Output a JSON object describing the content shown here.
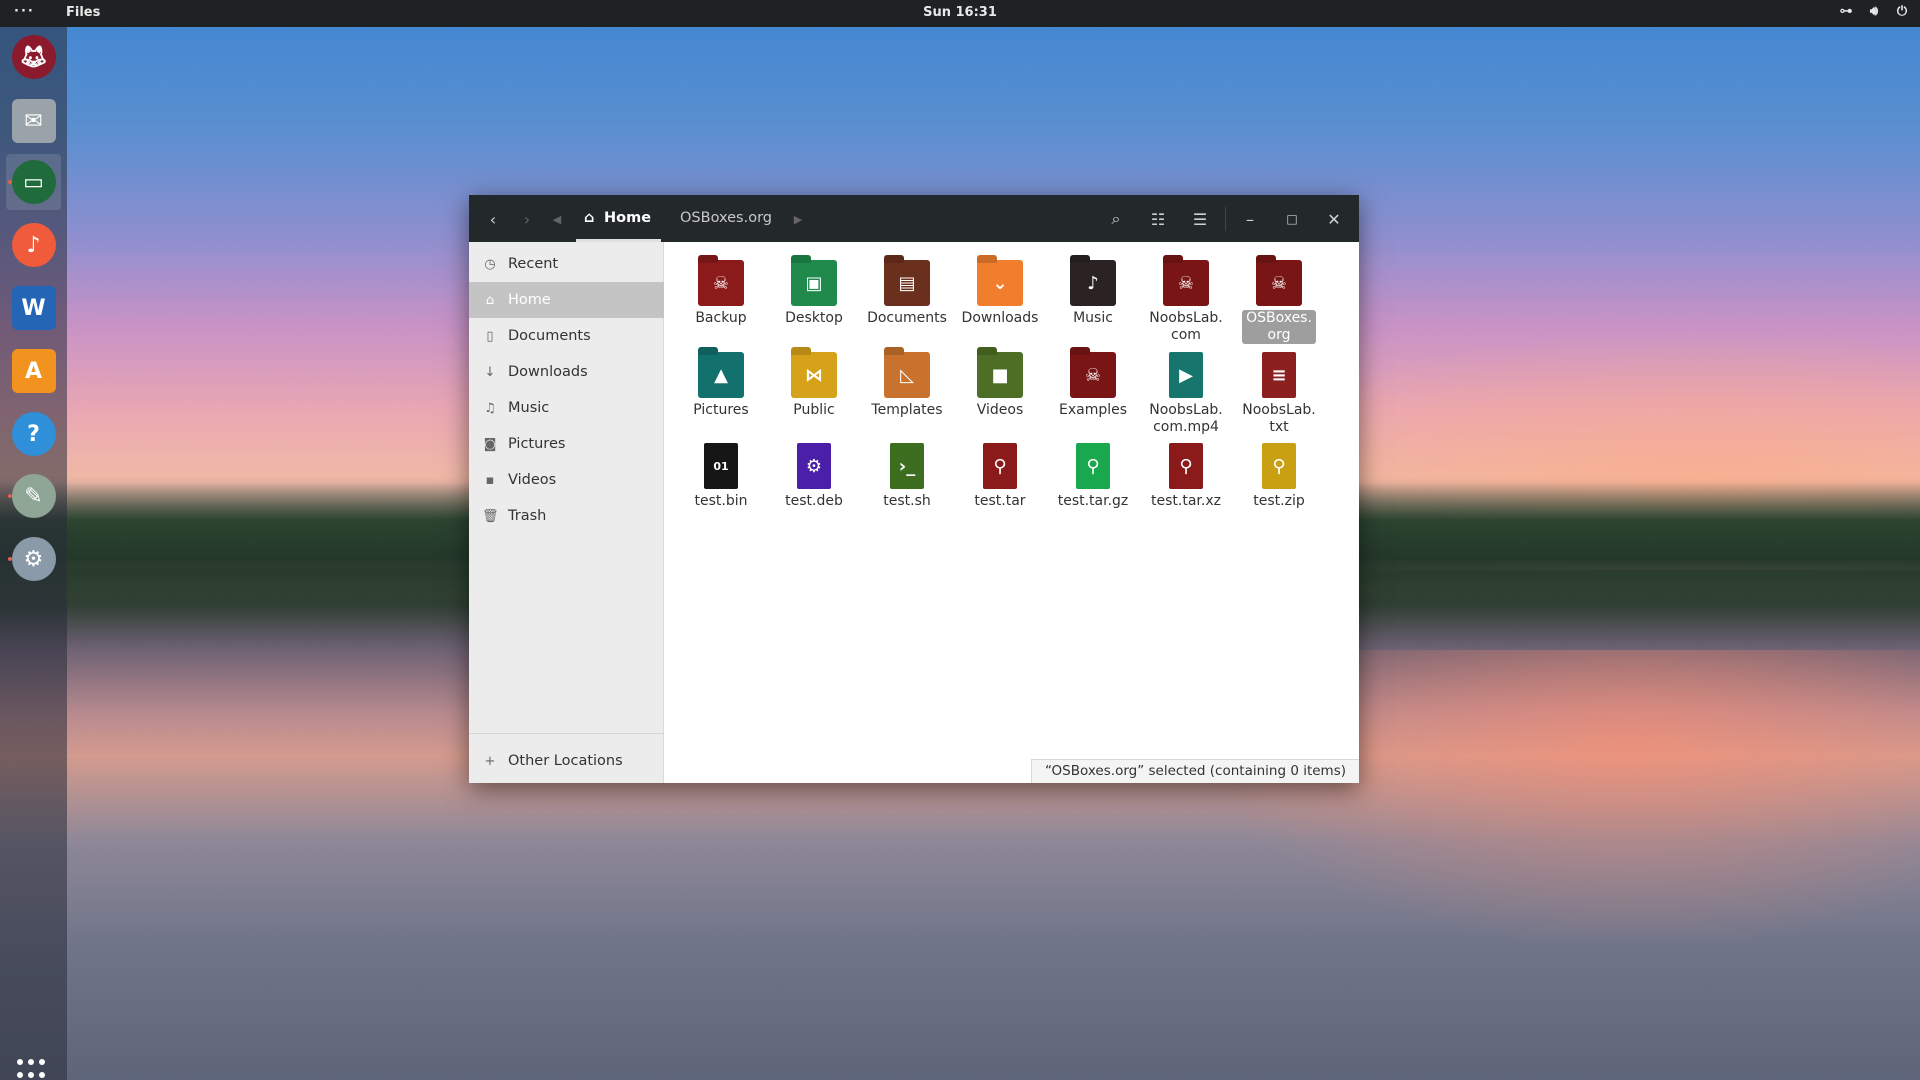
{
  "topbar": {
    "activities": "···",
    "app_name": "Files",
    "clock": "Sun 16:31",
    "tray_icons": [
      "network-icon",
      "volume-icon",
      "power-icon"
    ]
  },
  "dock": {
    "items": [
      {
        "name": "browser",
        "icon": "fox-icon",
        "color": "#8a1a2c"
      },
      {
        "name": "mail",
        "icon": "mail-icon",
        "color": "#9aa3a9"
      },
      {
        "name": "files",
        "icon": "folder-icon",
        "color": "#1f6b3b",
        "active": true
      },
      {
        "name": "music",
        "icon": "music-note-icon",
        "color": "#f05c3b"
      },
      {
        "name": "writer",
        "icon": "document-icon",
        "color": "#2466b5"
      },
      {
        "name": "software",
        "icon": "app-store-icon",
        "color": "#f2931f"
      },
      {
        "name": "help",
        "icon": "help-icon",
        "color": "#2f8fd8"
      },
      {
        "name": "tweaks",
        "icon": "tweak-icon",
        "color": "#8fa596"
      },
      {
        "name": "settings",
        "icon": "settings-icon",
        "color": "#8a9aa8"
      }
    ]
  },
  "window": {
    "breadcrumb_home": "Home",
    "breadcrumb_next": "OSBoxes.org",
    "sidebar": [
      {
        "label": "Recent",
        "icon": "clock-icon"
      },
      {
        "label": "Home",
        "icon": "home-icon",
        "selected": true
      },
      {
        "label": "Documents",
        "icon": "document-icon"
      },
      {
        "label": "Downloads",
        "icon": "download-icon"
      },
      {
        "label": "Music",
        "icon": "music-icon"
      },
      {
        "label": "Pictures",
        "icon": "camera-icon"
      },
      {
        "label": "Videos",
        "icon": "video-icon"
      },
      {
        "label": "Trash",
        "icon": "trash-icon"
      },
      {
        "label": "Other Locations",
        "icon": "plus-icon"
      }
    ],
    "files": [
      {
        "label": "Backup",
        "kind": "folder",
        "color": "#8b1a1a",
        "glyph": "☠"
      },
      {
        "label": "Desktop",
        "kind": "folder",
        "color": "#1f8a4c",
        "glyph": "▣"
      },
      {
        "label": "Documents",
        "kind": "folder",
        "color": "#6b2f1d",
        "glyph": "▤"
      },
      {
        "label": "Downloads",
        "kind": "folder",
        "color": "#f07e2c",
        "glyph": "⌄"
      },
      {
        "label": "Music",
        "kind": "folder",
        "color": "#2b2323",
        "glyph": "♪"
      },
      {
        "label": "NoobsLab.\ncom",
        "kind": "folder",
        "color": "#7a1515",
        "glyph": "☠"
      },
      {
        "label": "OSBoxes.\norg",
        "kind": "folder",
        "color": "#7a1515",
        "glyph": "☠",
        "selected": true
      },
      {
        "label": "Pictures",
        "kind": "folder",
        "color": "#12706d",
        "glyph": "▲"
      },
      {
        "label": "Public",
        "kind": "folder",
        "color": "#d6a219",
        "glyph": "⋈"
      },
      {
        "label": "Templates",
        "kind": "folder",
        "color": "#c8722d",
        "glyph": "◺"
      },
      {
        "label": "Videos",
        "kind": "folder",
        "color": "#4d6e25",
        "glyph": "■"
      },
      {
        "label": "Examples",
        "kind": "folder",
        "color": "#7a1515",
        "glyph": "☠"
      },
      {
        "label": "NoobsLab.\ncom.mp4",
        "kind": "doc",
        "color": "#16756c",
        "glyph": "▶"
      },
      {
        "label": "NoobsLab.\ntxt",
        "kind": "doc",
        "color": "#8c1f1f",
        "glyph": "≡"
      },
      {
        "label": "test.bin",
        "kind": "doc",
        "color": "#161616",
        "glyph": "01"
      },
      {
        "label": "test.deb",
        "kind": "doc",
        "color": "#4b1fa8",
        "glyph": "⚙"
      },
      {
        "label": "test.sh",
        "kind": "doc",
        "color": "#3d6e1f",
        "glyph": "›_"
      },
      {
        "label": "test.tar",
        "kind": "doc",
        "color": "#8b1a1a",
        "glyph": "⚲"
      },
      {
        "label": "test.tar.gz",
        "kind": "doc",
        "color": "#1aa84e",
        "glyph": "⚲"
      },
      {
        "label": "test.tar.xz",
        "kind": "doc",
        "color": "#8b1a1a",
        "glyph": "⚲"
      },
      {
        "label": "test.zip",
        "kind": "doc",
        "color": "#c9a012",
        "glyph": "⚲"
      }
    ],
    "status": "“OSBoxes.org” selected  (containing 0 items)"
  }
}
